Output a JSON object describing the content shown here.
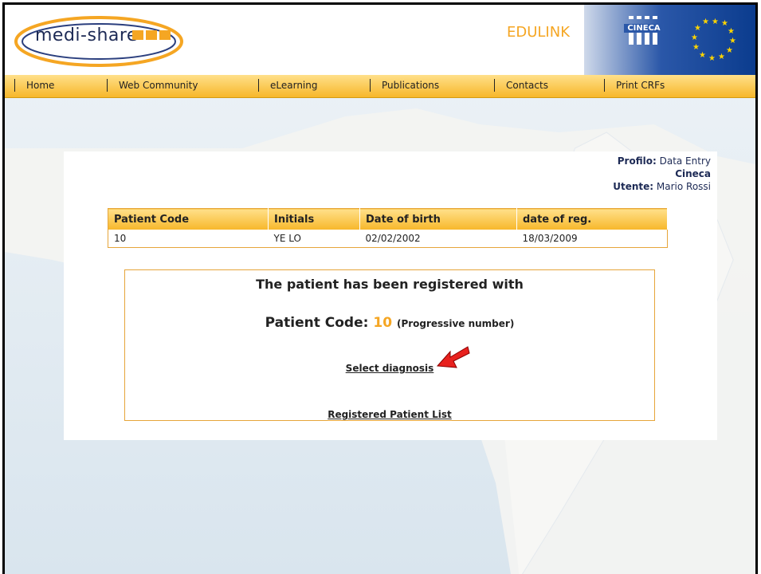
{
  "header": {
    "logo_text": "medi-share",
    "partner_text": "EDULINK",
    "cineca_text": "CINECA"
  },
  "nav": {
    "items": [
      {
        "label": "Home"
      },
      {
        "label": "Web Community"
      },
      {
        "label": "eLearning"
      },
      {
        "label": "Publications"
      },
      {
        "label": "Contacts"
      },
      {
        "label": "Print CRFs"
      }
    ]
  },
  "profile": {
    "profilo_label": "Profilo:",
    "profilo_value": "Data Entry",
    "org": "Cineca",
    "utente_label": "Utente:",
    "utente_value": "Mario Rossi"
  },
  "table": {
    "headers": [
      "Patient Code",
      "Initials",
      "Date of birth",
      "date of reg."
    ],
    "rows": [
      [
        "10",
        "YE LO",
        "02/02/2002",
        "18/03/2009"
      ]
    ]
  },
  "message": {
    "line1": "The patient has been registered with",
    "code_label": "Patient Code:",
    "code_value": "10",
    "code_note": "(Progressive number)",
    "select_diagnosis": "Select diagnosis",
    "registered_list": "Registered Patient List"
  },
  "colors": {
    "accent": "#f5a623",
    "nav_bg": "#f7b72a",
    "text_dark": "#1d2a55"
  }
}
